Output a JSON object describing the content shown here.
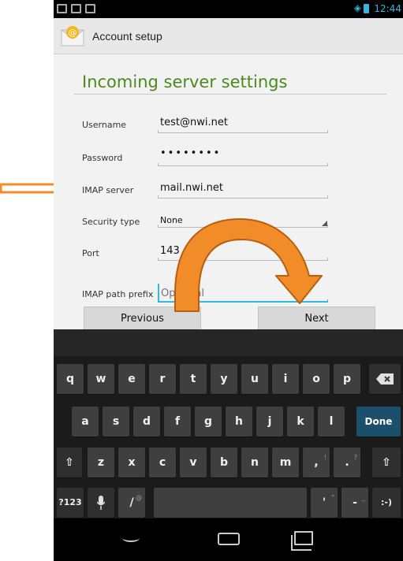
{
  "status_bar": {
    "time": "12:44",
    "wifi_icon": "wifi-icon",
    "battery_icon": "battery-icon"
  },
  "action_bar": {
    "title": "Account setup",
    "app_icon": "email-app-icon"
  },
  "page": {
    "heading": "Incoming server settings"
  },
  "fields": {
    "username": {
      "label": "Username",
      "value": "test@nwi.net"
    },
    "password": {
      "label": "Password",
      "value": "••••••••"
    },
    "imap_server": {
      "label": "IMAP server",
      "value": "mail.nwi.net"
    },
    "security_type": {
      "label": "Security type",
      "value": "None"
    },
    "port": {
      "label": "Port",
      "value": "143"
    },
    "imap_path_prefix": {
      "label": "IMAP path prefix",
      "placeholder": "Optional"
    }
  },
  "buttons": {
    "previous": "Previous",
    "next": "Next"
  },
  "keyboard": {
    "row1": [
      "q",
      "w",
      "e",
      "r",
      "t",
      "y",
      "u",
      "i",
      "o",
      "p"
    ],
    "row2": [
      "a",
      "s",
      "d",
      "f",
      "g",
      "h",
      "j",
      "k",
      "l"
    ],
    "done": "Done",
    "row3": [
      "z",
      "x",
      "c",
      "v",
      "b",
      "n",
      "m",
      ",",
      "."
    ],
    "row3_hints": {
      "comma": "!",
      "period": "?"
    },
    "sym": "?123",
    "slash": "/",
    "slash_hint": "@",
    "apostrophe": "'",
    "apostrophe_hint": "\"",
    "dash": "-",
    "dash_hint": "_",
    "smiley": ":-)",
    "icons": [
      "backspace-icon",
      "shift-icon",
      "microphone-icon"
    ]
  },
  "colors": {
    "heading": "#4a8b1c",
    "accent": "#33b5e5",
    "annotation": "#f28c28",
    "done_key": "#1c4f6b"
  }
}
